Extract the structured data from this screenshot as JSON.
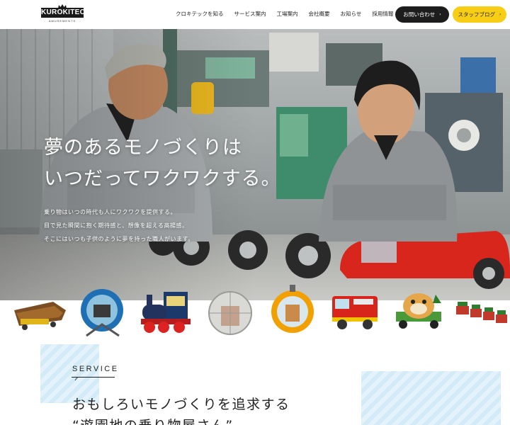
{
  "header": {
    "logo_text": "KUROKITEC",
    "logo_sub": "AMUSEMENTS",
    "nav": [
      "クロキテックを知る",
      "サービス案内",
      "工場案内",
      "会社概要",
      "お知らせ",
      "採用情報"
    ],
    "contact_label": "お問い合わせ",
    "blog_label": "スタッフブログ",
    "contact_color": "#1d1d1d",
    "blog_color": "#f7cd16"
  },
  "hero": {
    "headline_line1": "夢のあるモノづくりは",
    "headline_line2": "いつだってワクワクする。",
    "sub_line1": "乗り物はいつの時代も人にワクワクを提供する。",
    "sub_line2": "目で見た瞬間に抱く期待感と、想像を超える高揚感。",
    "sub_line3": "そこにはいつも子供のように夢を持った職人がいます。"
  },
  "products": [
    "log-ride-icon",
    "blue-wheel-ride-icon",
    "train-ride-icon",
    "glass-sphere-ride-icon",
    "orange-capsule-ride-icon",
    "fire-truck-ride-icon",
    "dog-car-ride-icon",
    "mini-train-ride-icon"
  ],
  "service": {
    "label": "SERVICE",
    "title_line1": "おもしろいモノづくりを追求する",
    "title_line2": "“遊園地の乗り物屋さん”"
  }
}
